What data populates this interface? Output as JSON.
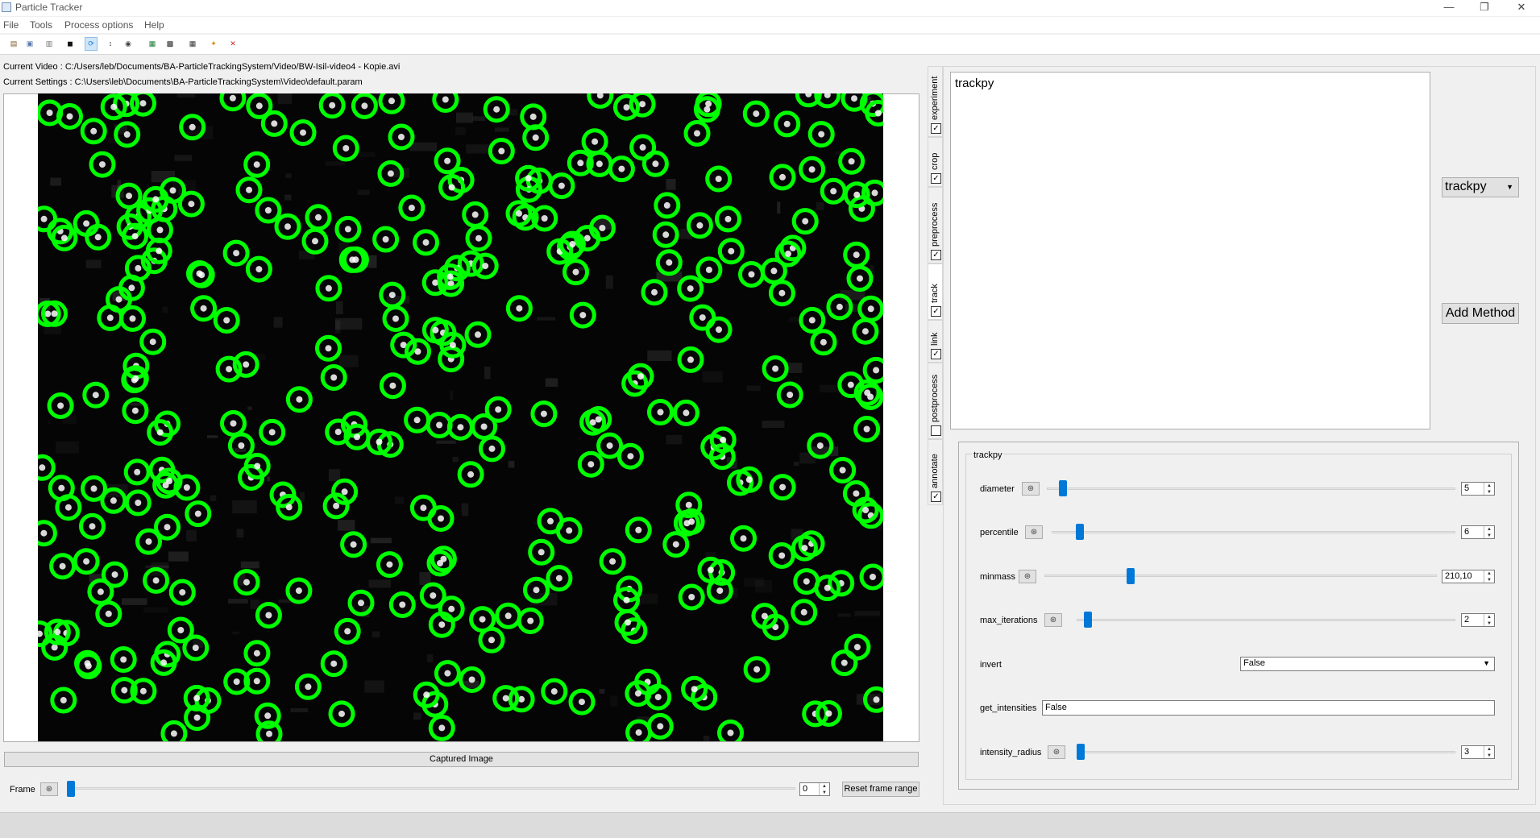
{
  "window": {
    "title": "Particle Tracker",
    "minimize": "—",
    "maximize": "❐",
    "close": "✕"
  },
  "menu": [
    "File",
    "Tools",
    "Process options",
    "Help"
  ],
  "toolbar": {
    "icons": [
      "open-file-icon",
      "open-settings-icon",
      "save-settings-icon",
      "save-icon",
      "refresh-icon",
      "statistics-icon",
      "camera-icon",
      "export-excel-icon",
      "movie-clapper-icon",
      "export-video-icon",
      "run-icon",
      "close-x-icon"
    ],
    "glyphs": [
      "▤",
      "▣",
      "▥",
      "◼",
      "⟳",
      "↕",
      "◉",
      "▦",
      "▩",
      "▦",
      "✦",
      "✕"
    ],
    "colors": [
      "#7a5a2b",
      "#5a7ab0",
      "#6f6f6f",
      "#111111",
      "#1a7fd4",
      "#333333",
      "#444444",
      "#1f7a3a",
      "#222222",
      "#333333",
      "#d88a00",
      "#d42020"
    ],
    "active_index": 4
  },
  "info": {
    "current_video": "Current Video :  C:/Users/leb/Documents/BA-ParticleTrackingSystem/Video/BW-Isil-video4 - Kopie.avi",
    "current_settings": "Current Settings :  C:\\Users\\leb\\Documents\\BA-ParticleTrackingSystem\\Video\\default.param"
  },
  "video": {
    "captured_label": "Captured Image",
    "frame_label": "Frame",
    "frame_value": "0",
    "frame_fraction": 0.0,
    "reset_label": "Reset frame range",
    "marker_color": "#00ff00"
  },
  "tabs": [
    {
      "name": "experiment",
      "checked": true
    },
    {
      "name": "crop",
      "checked": true
    },
    {
      "name": "preprocess",
      "checked": true
    },
    {
      "name": "track",
      "checked": true,
      "selected": true
    },
    {
      "name": "link",
      "checked": true
    },
    {
      "name": "postprocess",
      "checked": false
    },
    {
      "name": "annotate",
      "checked": true
    }
  ],
  "methods": {
    "list": [
      "trackpy"
    ],
    "selected_method": "trackpy",
    "add_label": "Add Method"
  },
  "params": {
    "group_title": "trackpy",
    "diameter": {
      "label": "diameter",
      "value": "5",
      "fraction": 0.03
    },
    "percentile": {
      "label": "percentile",
      "value": "6",
      "fraction": 0.06
    },
    "minmass": {
      "label": "minmass",
      "value": "210,10",
      "fraction": 0.21
    },
    "max_iterations": {
      "label": "max_iterations",
      "value": "2",
      "fraction": 0.02
    },
    "invert": {
      "label": "invert",
      "value": "False"
    },
    "get_intensities": {
      "label": "get_intensities",
      "value": "False"
    },
    "intensity_radius": {
      "label": "intensity_radius",
      "value": "3",
      "fraction": 0.0
    }
  }
}
